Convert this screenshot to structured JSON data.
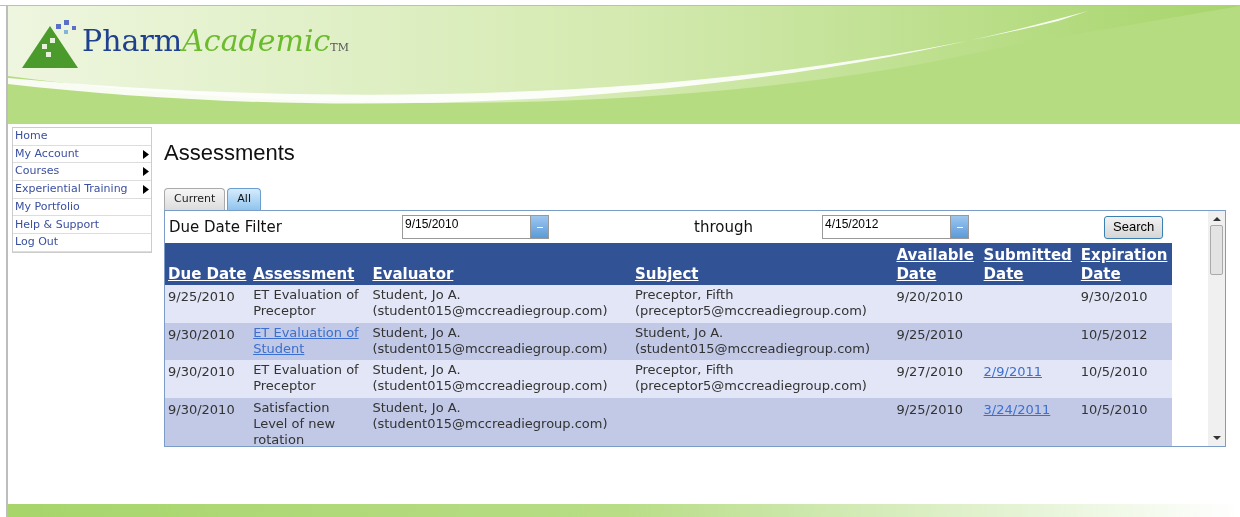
{
  "logo": {
    "name_part1": "Pharm",
    "name_part2": "Academic",
    "trademark": "TM"
  },
  "sidebar": {
    "items": [
      {
        "label": "Home",
        "has_submenu": false
      },
      {
        "label": "My Account",
        "has_submenu": true
      },
      {
        "label": "Courses",
        "has_submenu": true
      },
      {
        "label": "Experiential Training",
        "has_submenu": true
      },
      {
        "label": "My Portfolio",
        "has_submenu": false
      },
      {
        "label": "Help & Support",
        "has_submenu": false
      },
      {
        "label": "Log Out",
        "has_submenu": false
      }
    ]
  },
  "page_title": "Assessments",
  "tabs": [
    {
      "label": "Current",
      "selected": false
    },
    {
      "label": "All",
      "selected": true
    }
  ],
  "filter": {
    "label": "Due Date Filter",
    "from": "9/15/2010",
    "through_label": "through",
    "to": "4/15/2012",
    "search_button": "Search"
  },
  "table": {
    "columns": [
      "Due Date",
      "Assessment",
      "Evaluator",
      "Subject",
      "Available Date",
      "Submitted Date",
      "Expiration Date"
    ],
    "rows": [
      {
        "cells": [
          {
            "lines": [
              "9/25/2010"
            ],
            "link": false
          },
          {
            "lines": [
              "ET Evaluation of",
              "Preceptor"
            ],
            "link": false
          },
          {
            "lines": [
              "Student, Jo A.",
              "(student015@mccreadiegroup.com)"
            ],
            "link": false
          },
          {
            "lines": [
              "Preceptor, Fifth",
              "(preceptor5@mccreadiegroup.com)"
            ],
            "link": false
          },
          {
            "lines": [
              "9/20/2010"
            ],
            "link": false
          },
          null,
          {
            "lines": [
              "9/30/2010"
            ],
            "link": false
          }
        ]
      },
      {
        "cells": [
          {
            "lines": [
              "9/30/2010"
            ],
            "link": false
          },
          {
            "lines": [
              "ET Evaluation of",
              "Student"
            ],
            "link": true
          },
          {
            "lines": [
              "Student, Jo A.",
              "(student015@mccreadiegroup.com)"
            ],
            "link": false
          },
          {
            "lines": [
              "Student, Jo A.",
              "(student015@mccreadiegroup.com)"
            ],
            "link": false
          },
          {
            "lines": [
              "9/25/2010"
            ],
            "link": false
          },
          null,
          {
            "lines": [
              "10/5/2012"
            ],
            "link": false
          }
        ]
      },
      {
        "cells": [
          {
            "lines": [
              "9/30/2010"
            ],
            "link": false
          },
          {
            "lines": [
              "ET Evaluation of",
              "Preceptor"
            ],
            "link": false
          },
          {
            "lines": [
              "Student, Jo A.",
              "(student015@mccreadiegroup.com)"
            ],
            "link": false
          },
          {
            "lines": [
              "Preceptor, Fifth",
              "(preceptor5@mccreadiegroup.com)"
            ],
            "link": false
          },
          {
            "lines": [
              "9/27/2010"
            ],
            "link": false
          },
          {
            "lines": [
              "2/9/2011"
            ],
            "link": true
          },
          {
            "lines": [
              "10/5/2010"
            ],
            "link": false
          }
        ]
      },
      {
        "cells": [
          {
            "lines": [
              "9/30/2010"
            ],
            "link": false
          },
          {
            "lines": [
              "Satisfaction",
              "Level of new",
              "rotation"
            ],
            "link": false
          },
          {
            "lines": [
              "Student, Jo A.",
              "(student015@mccreadiegroup.com)"
            ],
            "link": false
          },
          null,
          {
            "lines": [
              "9/25/2010"
            ],
            "link": false
          },
          {
            "lines": [
              "3/24/2011"
            ],
            "link": true
          },
          {
            "lines": [
              "10/5/2010"
            ],
            "link": false
          }
        ]
      }
    ]
  }
}
